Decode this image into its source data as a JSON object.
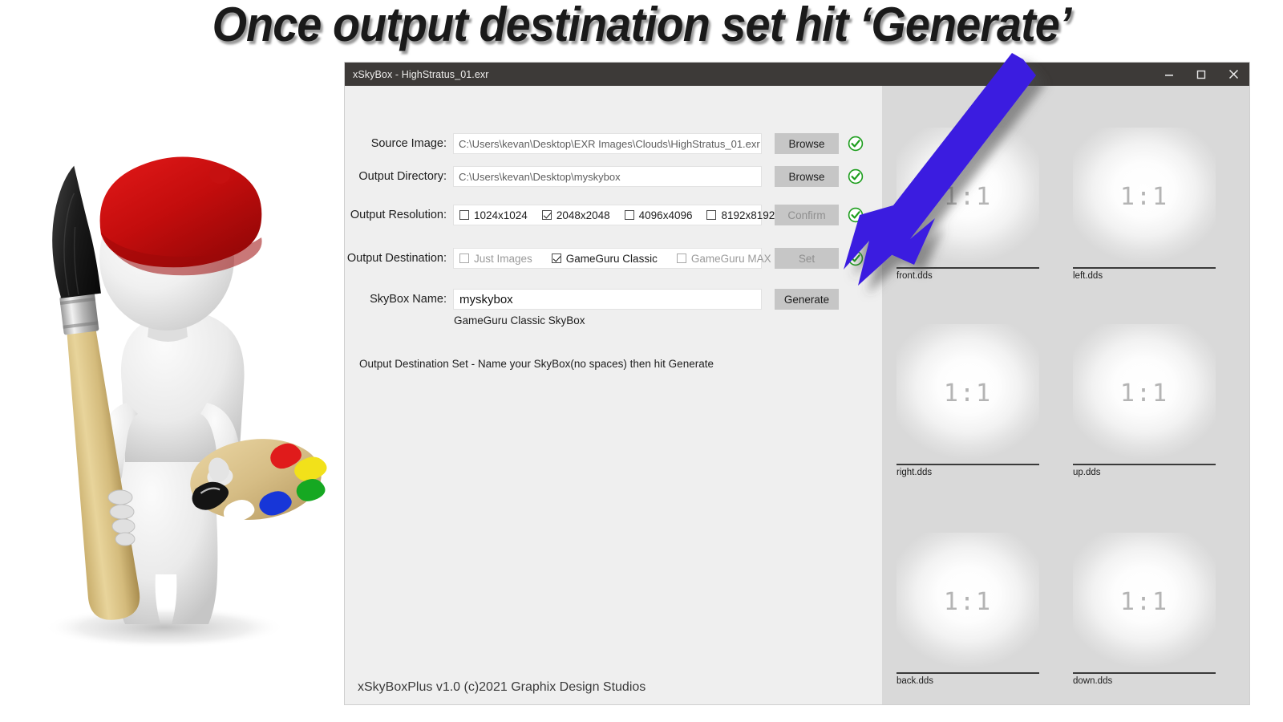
{
  "annotation": {
    "headline": "Once output destination set hit ‘Generate’",
    "arrow_color": "#3b1fe0",
    "arrow_target": "generate-button"
  },
  "window": {
    "title": "xSkyBox - HighStratus_01.exr",
    "controls": {
      "minimize": "minimize-icon",
      "maximize": "maximize-icon",
      "close": "close-icon"
    }
  },
  "form": {
    "rows": [
      {
        "label": "Source Image:",
        "value": "C:\\Users\\kevan\\Desktop\\EXR Images\\Clouds\\HighStratus_01.exr",
        "button": "Browse",
        "button_disabled": false,
        "status": "check-ok"
      },
      {
        "label": "Output Directory:",
        "value": "C:\\Users\\kevan\\Desktop\\myskybox",
        "button": "Browse",
        "button_disabled": false,
        "status": "check-ok"
      },
      {
        "label": "Output Resolution:",
        "button": "Confirm",
        "button_disabled": true,
        "status": "check-ok"
      },
      {
        "label": "Output Destination:",
        "button": "Set",
        "button_disabled": true,
        "status": "check-ok"
      },
      {
        "label": "SkyBox Name:",
        "value": "myskybox",
        "button": "Generate",
        "button_disabled": false
      }
    ],
    "resolution_options": [
      {
        "label": "1024x1024",
        "checked": false,
        "dim": false
      },
      {
        "label": "2048x2048",
        "checked": true,
        "dim": false
      },
      {
        "label": "4096x4096",
        "checked": false,
        "dim": false
      },
      {
        "label": "8192x8192",
        "checked": false,
        "dim": false
      }
    ],
    "destination_options": [
      {
        "label": "Just Images",
        "checked": false,
        "dim": true
      },
      {
        "label": "GameGuru Classic",
        "checked": true,
        "dim": false
      },
      {
        "label": "GameGuru MAX",
        "checked": false,
        "dim": true
      }
    ],
    "skybox_type_note": "GameGuru Classic SkyBox",
    "status_message": "Output Destination Set - Name your SkyBox(no spaces) then hit Generate"
  },
  "preview": {
    "ratio_text": "1:1",
    "thumbs": [
      {
        "label": "front.dds"
      },
      {
        "label": "left.dds"
      },
      {
        "label": "right.dds"
      },
      {
        "label": "up.dds"
      },
      {
        "label": "back.dds"
      },
      {
        "label": "down.dds"
      }
    ]
  },
  "footer": "xSkyBoxPlus v1.0 (c)2021 Graphix Design Studios"
}
